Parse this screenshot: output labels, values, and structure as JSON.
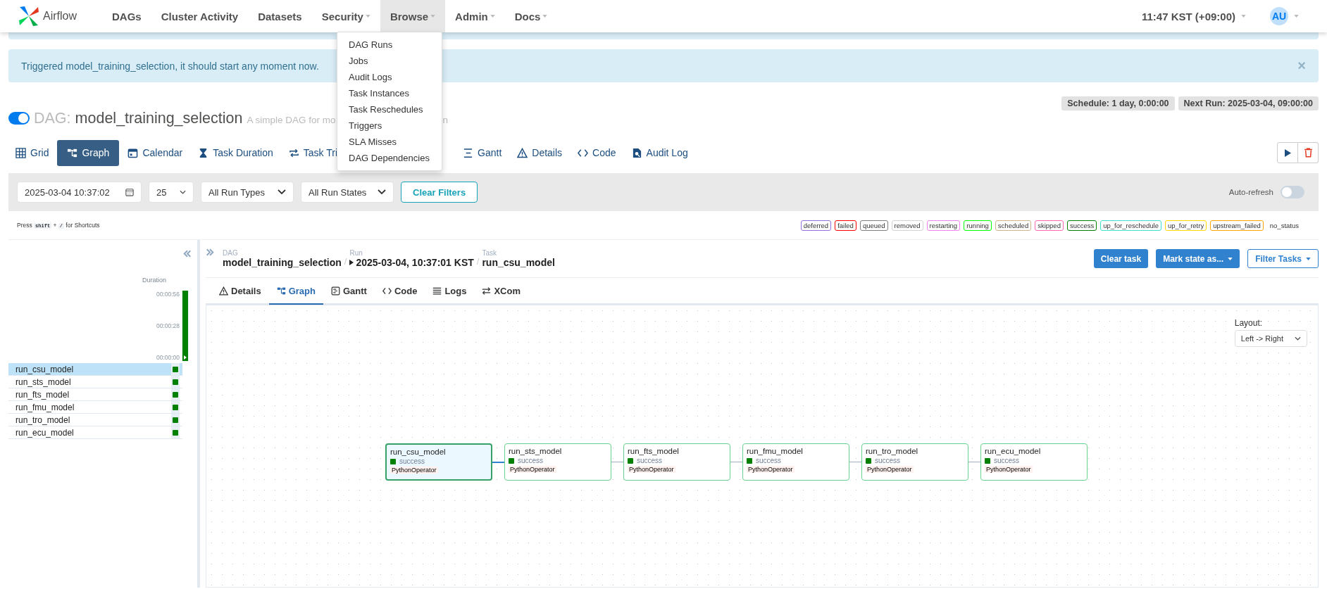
{
  "nav": {
    "brand": "Airflow",
    "items": [
      {
        "label": "DAGs",
        "dropdown": false,
        "selected": false
      },
      {
        "label": "Cluster Activity",
        "dropdown": false,
        "selected": false
      },
      {
        "label": "Datasets",
        "dropdown": false,
        "selected": false
      },
      {
        "label": "Security",
        "dropdown": true,
        "selected": false
      },
      {
        "label": "Browse",
        "dropdown": true,
        "selected": true
      },
      {
        "label": "Admin",
        "dropdown": true,
        "selected": false
      },
      {
        "label": "Docs",
        "dropdown": true,
        "selected": false
      }
    ],
    "time": "11:47 KST (+09:00)",
    "user": "AU"
  },
  "browse_menu": [
    "DAG Runs",
    "Jobs",
    "Audit Logs",
    "Task Instances",
    "Task Reschedules",
    "Triggers",
    "SLA Misses",
    "DAG Dependencies"
  ],
  "alert": {
    "text": "Triggered model_training_selection, it should start any moment now.",
    "close": "×"
  },
  "dag": {
    "on": true,
    "prefix": "DAG:",
    "name": "model_training_selection",
    "description_visible": [
      "A simple DAG for mo",
      "n"
    ],
    "schedule": "Schedule: 1 day, 0:00:00",
    "next_run": "Next Run: 2025-03-04, 09:00:00"
  },
  "view_tabs": [
    {
      "label": "Grid",
      "kind": "grid",
      "selected": false
    },
    {
      "label": "Graph",
      "kind": "graph",
      "selected": true
    },
    {
      "label": "Calendar",
      "kind": "calendar",
      "selected": false
    },
    {
      "label": "Task Duration",
      "kind": "hourglass",
      "selected": false
    },
    {
      "label": "Task Tri",
      "kind": "tries",
      "selected": false
    },
    {
      "label": "Gantt",
      "kind": "gantt",
      "selected": false
    },
    {
      "label": "Details",
      "kind": "warning",
      "selected": false
    },
    {
      "label": "Code",
      "kind": "code",
      "selected": false
    },
    {
      "label": "Audit Log",
      "kind": "log",
      "selected": false
    }
  ],
  "filters": {
    "date": "2025-03-04 10:37:02",
    "count": "25",
    "run_types": "All Run Types",
    "run_states": "All Run States",
    "clear": "Clear Filters",
    "auto_refresh_label": "Auto-refresh",
    "auto_refresh": false
  },
  "shortcuts": {
    "press": "Press",
    "key1": "shift",
    "plus": "+",
    "key2": "/",
    "rest": "for Shortcuts"
  },
  "legend": [
    {
      "label": "deferred",
      "color": "#9370db"
    },
    {
      "label": "failed",
      "color": "#ff0000"
    },
    {
      "label": "queued",
      "color": "#808080"
    },
    {
      "label": "removed",
      "color": "#d3d3d3"
    },
    {
      "label": "restarting",
      "color": "#ee82ee"
    },
    {
      "label": "running",
      "color": "#00ff00"
    },
    {
      "label": "scheduled",
      "color": "#d2b48c"
    },
    {
      "label": "skipped",
      "color": "#ff69b4"
    },
    {
      "label": "success",
      "color": "#008000"
    },
    {
      "label": "up_for_reschedule",
      "color": "#40e0d0"
    },
    {
      "label": "up_for_retry",
      "color": "#ffd700"
    },
    {
      "label": "upstream_failed",
      "color": "#ffa500"
    },
    {
      "label": "no_status"
    }
  ],
  "grid": {
    "duration_label": "Duration",
    "ticks": [
      "00:00:56",
      "00:00:28",
      "00:00:00"
    ],
    "tasks": [
      {
        "name": "run_csu_model",
        "selected": true,
        "color": "#008000"
      },
      {
        "name": "run_sts_model",
        "selected": false,
        "color": "#008000"
      },
      {
        "name": "run_fts_model",
        "selected": false,
        "color": "#008000"
      },
      {
        "name": "run_fmu_model",
        "selected": false,
        "color": "#008000"
      },
      {
        "name": "run_tro_model",
        "selected": false,
        "color": "#008000"
      },
      {
        "name": "run_ecu_model",
        "selected": false,
        "color": "#008000"
      }
    ]
  },
  "breadcrumb_separator": "/",
  "breadcrumb": [
    {
      "label": "DAG",
      "value": "model_training_selection",
      "kind": "dag"
    },
    {
      "label": "Run",
      "value": "2025-03-04, 10:37:01 KST",
      "kind": "run"
    },
    {
      "label": "Task",
      "value": "run_csu_model",
      "kind": "task"
    }
  ],
  "actions": [
    {
      "label": "Clear task",
      "kind": "solid",
      "caret": false
    },
    {
      "label": "Mark state as...",
      "kind": "solid",
      "caret": true
    },
    {
      "label": "Filter Tasks",
      "kind": "outline",
      "caret": true
    }
  ],
  "detail_tabs": [
    {
      "label": "Details",
      "kind": "warning",
      "selected": false
    },
    {
      "label": "Graph",
      "kind": "graph",
      "selected": true
    },
    {
      "label": "Gantt",
      "kind": "gantt",
      "selected": false
    },
    {
      "label": "Code",
      "kind": "code",
      "selected": false
    },
    {
      "label": "Logs",
      "kind": "logs",
      "selected": false
    },
    {
      "label": "XCom",
      "kind": "xcom",
      "selected": false
    }
  ],
  "graph": {
    "layout_label": "Layout:",
    "layout": "Left -> Right",
    "nodes": [
      {
        "name": "run_csu_model",
        "state": "success",
        "operator": "PythonOperator",
        "selected": true,
        "color": "#008000"
      },
      {
        "name": "run_sts_model",
        "state": "success",
        "operator": "PythonOperator",
        "selected": false,
        "color": "#008000"
      },
      {
        "name": "run_fts_model",
        "state": "success",
        "operator": "PythonOperator",
        "selected": false,
        "color": "#008000"
      },
      {
        "name": "run_fmu_model",
        "state": "success",
        "operator": "PythonOperator",
        "selected": false,
        "color": "#008000"
      },
      {
        "name": "run_tro_model",
        "state": "success",
        "operator": "PythonOperator",
        "selected": false,
        "color": "#008000"
      },
      {
        "name": "run_ecu_model",
        "state": "success",
        "operator": "PythonOperator",
        "selected": false,
        "color": "#008000"
      }
    ]
  }
}
